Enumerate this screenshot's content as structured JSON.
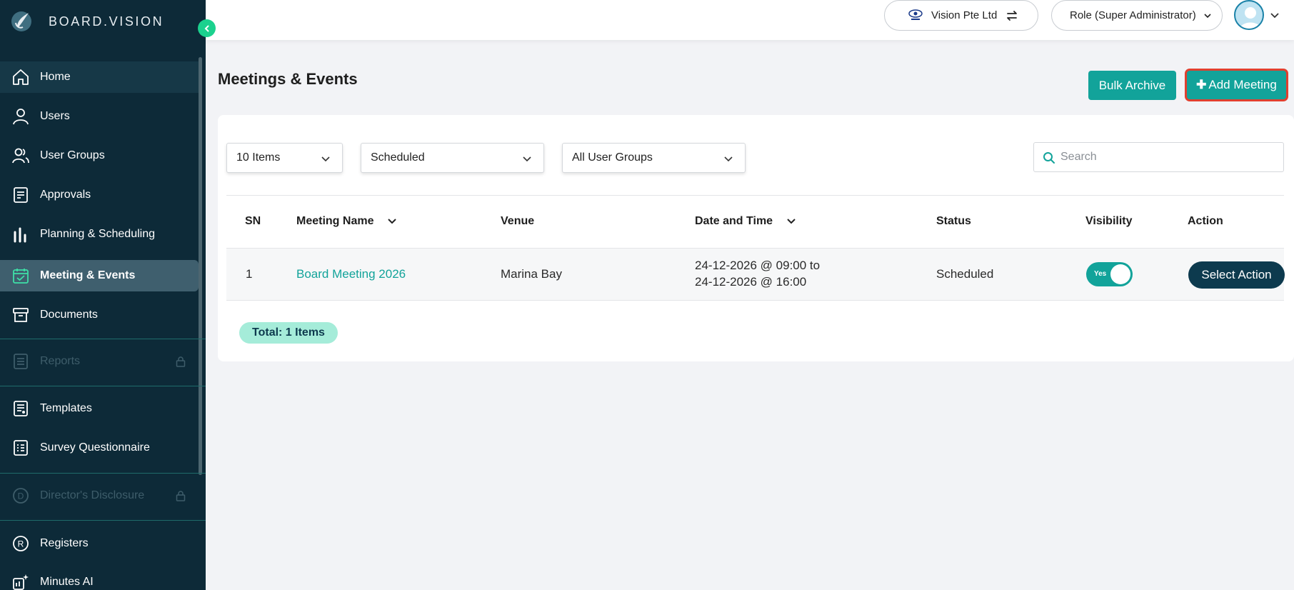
{
  "brand": {
    "name": "BOARD.VISION"
  },
  "sidebar": {
    "items": [
      {
        "label": "Home",
        "icon": "home-icon"
      },
      {
        "label": "Users",
        "icon": "user-icon"
      },
      {
        "label": "User Groups",
        "icon": "users-icon"
      },
      {
        "label": "Approvals",
        "icon": "approval-icon"
      },
      {
        "label": "Planning & Scheduling",
        "icon": "bar-chart-icon"
      },
      {
        "label": "Meeting & Events",
        "icon": "calendar-check-icon",
        "active": true
      },
      {
        "label": "Documents",
        "icon": "archive-box-icon"
      },
      {
        "label": "Reports",
        "icon": "report-list-icon",
        "locked": true
      },
      {
        "label": "Templates",
        "icon": "template-icon"
      },
      {
        "label": "Survey Questionnaire",
        "icon": "survey-icon"
      },
      {
        "label": "Director's Disclosure",
        "icon": "d-circle-icon",
        "locked": true
      },
      {
        "label": "Registers",
        "icon": "r-circle-icon"
      },
      {
        "label": "Minutes AI",
        "icon": "minutes-ai-icon"
      }
    ]
  },
  "topbar": {
    "organization": "Vision Pte Ltd",
    "role": "Role (Super Administrator)"
  },
  "main": {
    "title": "Meetings & Events",
    "bulk_archive_label": "Bulk Archive",
    "add_meeting_label": "Add Meeting",
    "filters": {
      "page_size": "10 Items",
      "status": "Scheduled",
      "user_group": "All User Groups",
      "search_placeholder": "Search"
    },
    "table": {
      "headers": [
        "SN",
        "Meeting Name",
        "Venue",
        "Date and Time",
        "Status",
        "Visibility",
        "Action"
      ],
      "rows": [
        {
          "sn": "1",
          "meeting_name": "Board Meeting 2026",
          "venue": "Marina Bay",
          "date_line1": "24-12-2026 @ 09:00 to",
          "date_line2": "24-12-2026 @ 16:00",
          "status": "Scheduled",
          "visibility": "Yes",
          "action": "Select Action"
        }
      ]
    },
    "total": "Total: 1 Items"
  },
  "colors": {
    "sidebar_bg": "#0d2a38",
    "accent": "#12a39a",
    "collapse_button": "#1bd18e",
    "highlight_border": "#e0402f",
    "action_button": "#0d3a4e",
    "total_badge": "#a5ecd9"
  }
}
